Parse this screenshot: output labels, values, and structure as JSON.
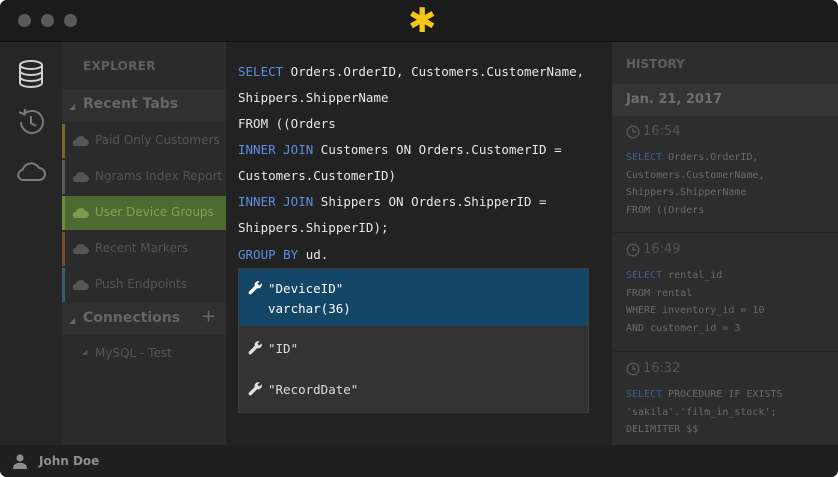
{
  "colors": {
    "accent_logo": "#f5c518",
    "keyword": "#5b8fe0",
    "selected_suggestion": "#134566",
    "active_tab": "#4d6a30"
  },
  "iconbar": {
    "items": [
      "database-icon",
      "history-icon",
      "cloud-icon"
    ]
  },
  "explorer": {
    "title": "EXPLORER",
    "recent_tabs_label": "Recent Tabs",
    "tabs": [
      {
        "label": "Paid Only Customers",
        "color": "#7a6a2a"
      },
      {
        "label": "Ngrams Index Report",
        "color": "#6a6a6a"
      },
      {
        "label": "User Device Groups",
        "color": "#6f8a3a",
        "active": true
      },
      {
        "label": "Recent Markers",
        "color": "#7a4a2a"
      },
      {
        "label": "Push Endpoints",
        "color": "#3a5a6a"
      }
    ],
    "connections_label": "Connections",
    "add_symbol": "+",
    "connections": [
      {
        "label": "MySQL - Test"
      }
    ]
  },
  "editor": {
    "lines": [
      [
        {
          "k": true,
          "t": "SELECT"
        },
        {
          "t": " Orders.OrderID, Customers.CustomerName,"
        }
      ],
      [
        {
          "t": "Shippers.ShipperName"
        }
      ],
      [
        {
          "t": "FROM ((Orders"
        }
      ],
      [
        {
          "k": true,
          "t": "INNER JOIN"
        },
        {
          "t": " Customers ON Orders.CustomerID ="
        }
      ],
      [
        {
          "t": "Customers.CustomerID)"
        }
      ],
      [
        {
          "k": true,
          "t": "INNER JOIN"
        },
        {
          "t": " Shippers ON Orders.ShipperID ="
        }
      ],
      [
        {
          "t": "Shippers.ShipperID);"
        }
      ],
      [
        {
          "k": true,
          "t": "GROUP BY"
        },
        {
          "t": " ud."
        }
      ]
    ],
    "autocomplete": [
      {
        "name": "\"DeviceID\"",
        "type": "varchar(36)",
        "selected": true
      },
      {
        "name": "\"ID\""
      },
      {
        "name": "\"RecordDate\""
      }
    ]
  },
  "history": {
    "title": "HISTORY",
    "date": "Jan. 21, 2017",
    "entries": [
      {
        "time": "16:54",
        "sql": [
          [
            {
              "k": true,
              "t": "SELECT"
            },
            {
              "t": " Orders.OrderID,"
            }
          ],
          [
            {
              "t": "Customers.CustomerName,"
            }
          ],
          [
            {
              "t": "Shippers.ShipperName"
            }
          ],
          [
            {
              "t": "FROM ((Orders"
            }
          ]
        ]
      },
      {
        "time": "16:49",
        "sql": [
          [
            {
              "k": true,
              "t": "SELECT"
            },
            {
              "t": " rental_id"
            }
          ],
          [
            {
              "t": "FROM rental"
            }
          ],
          [
            {
              "t": "WHERE inventory_id = 10"
            }
          ],
          [
            {
              "t": "AND customer_id = 3"
            }
          ]
        ]
      },
      {
        "time": "16:32",
        "sql": [
          [
            {
              "k": true,
              "t": "SELECT"
            },
            {
              "t": " PROCEDURE IF EXISTS"
            }
          ],
          [
            {
              "t": "'sakila'.'film_in_stock';"
            }
          ],
          [
            {
              "t": "DELIMITER $$"
            }
          ]
        ]
      }
    ]
  },
  "statusbar": {
    "user": "John Doe"
  }
}
